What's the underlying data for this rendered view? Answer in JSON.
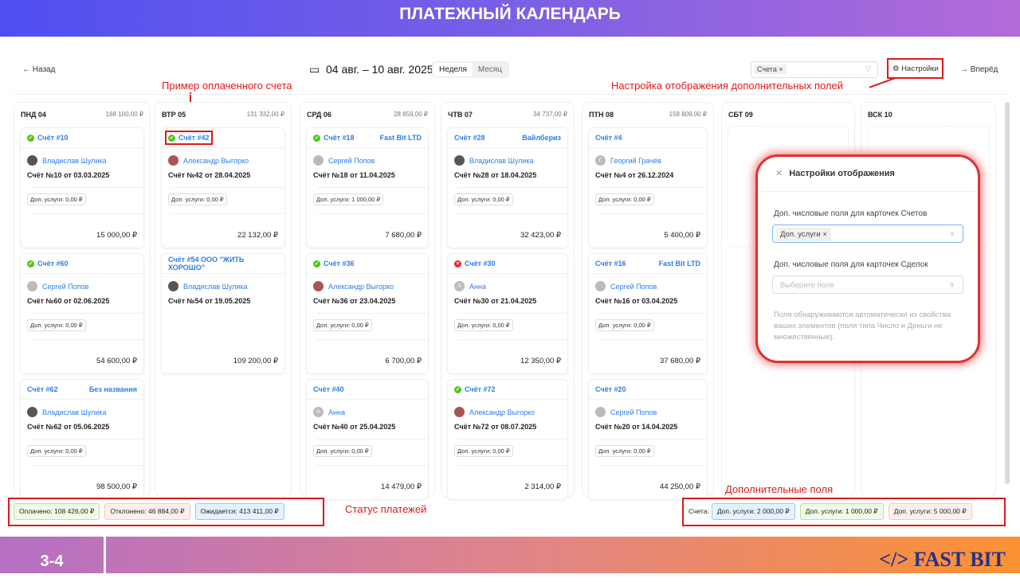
{
  "slide_title": "ПЛАТЕЖНЫЙ КАЛЕНДАРЬ",
  "page_number": "3-4",
  "logo_text": "</> FAST BIT",
  "toolbar": {
    "back": "Назад",
    "date_range": "04 авг. – 10 авг. 2025",
    "view_week": "Неделя",
    "view_month": "Месяц",
    "filter_chip": "Счета",
    "settings": "Настройки",
    "forward": "Вперёд"
  },
  "annotations": {
    "paid_example": "Пример оплаченного счета",
    "settings_note": "Настройка отображения дополнительных полей",
    "status_note": "Статус платежей",
    "extra_note": "Дополнительные поля"
  },
  "colors": {
    "paid": "#52c41a",
    "declined": "#f5222d",
    "link": "#2b7de9",
    "annotation": "#e01818"
  },
  "columns": [
    {
      "day": "ПНД 04",
      "total": "168 100,00 ₽",
      "cards": [
        {
          "title": "Счёт #10",
          "status": "paid",
          "org": "",
          "person": "Владислав Шулика",
          "av": "#555",
          "inv": "Счёт №10 от 03.03.2025",
          "tag": "Доп. услуги: 0,00 ₽",
          "amount": "15 000,00 ₽"
        },
        {
          "title": "Счёт #60",
          "status": "paid",
          "org": "",
          "person": "Сергей Попов",
          "av": "#bbb",
          "inv": "Счёт №60 от 02.06.2025",
          "tag": "Доп. услуги: 0,00 ₽",
          "amount": "54 600,00 ₽"
        },
        {
          "title": "Счёт #62",
          "status": "",
          "org": "Без названия",
          "person": "Владислав Шулика",
          "av": "#555",
          "inv": "Счёт №62 от 05.06.2025",
          "tag": "Доп. услуги: 0,00 ₽",
          "amount": "98 500,00 ₽"
        }
      ]
    },
    {
      "day": "ВТР 05",
      "total": "131 332,00 ₽",
      "cards": [
        {
          "title": "Счёт #42",
          "status": "paid",
          "org": "",
          "person": "Александр Выгорко",
          "av": "#a55",
          "inv": "Счёт №42 от 28.04.2025",
          "tag": "Доп. услуги: 0,00 ₽",
          "amount": "22 132,00 ₽"
        },
        {
          "title": "Счёт #54 ООО \"ЖИТЬ ХОРОШО\"",
          "status": "",
          "org": "",
          "person": "Владислав Шулика",
          "av": "#555",
          "inv": "Счёт №54 от 19.05.2025",
          "tag": "",
          "amount": "109 200,00 ₽"
        }
      ]
    },
    {
      "day": "СРД 06",
      "total": "28 859,00 ₽",
      "cards": [
        {
          "title": "Счёт #18",
          "status": "paid",
          "org": "Fast Bit LTD",
          "person": "Сергей Попов",
          "av": "#bbb",
          "inv": "Счёт №18 от 11.04.2025",
          "tag": "Доп. услуги: 1 000,00 ₽",
          "amount": "7 680,00 ₽"
        },
        {
          "title": "Счёт #36",
          "status": "paid",
          "org": "",
          "person": "Александр Выгорко",
          "av": "#a55",
          "inv": "Счёт №36 от 23.04.2025",
          "tag": "Доп. услуги: 0,00 ₽",
          "amount": "6 700,00 ₽"
        },
        {
          "title": "Счёт #40",
          "status": "",
          "org": "",
          "person": "Анна",
          "av": "#bbb",
          "letter": "А",
          "inv": "Счёт №40 от 25.04.2025",
          "tag": "Доп. услуги: 0,00 ₽",
          "amount": "14 479,00 ₽"
        }
      ]
    },
    {
      "day": "ЧТВ 07",
      "total": "34 737,00 ₽",
      "cards": [
        {
          "title": "Счёт #28",
          "status": "",
          "org": "Вайлбериз",
          "person": "Владислав Шулика",
          "av": "#555",
          "inv": "Счёт №28 от 18.04.2025",
          "tag": "Доп. услуги: 0,00 ₽",
          "amount": "32 423,00 ₽"
        },
        {
          "title": "Счёт #30",
          "status": "declined",
          "org": "",
          "person": "Анна",
          "av": "#bbb",
          "letter": "А",
          "inv": "Счёт №30 от 21.04.2025",
          "tag": "Доп. услуги: 0,00 ₽",
          "amount": "12 350,00 ₽"
        },
        {
          "title": "Счёт #72",
          "status": "paid",
          "org": "",
          "person": "Александр Выгорко",
          "av": "#a55",
          "inv": "Счёт №72 от 08.07.2025",
          "tag": "Доп. услуги: 0,00 ₽",
          "amount": "2 314,00 ₽"
        }
      ]
    },
    {
      "day": "ПТН 08",
      "total": "158 809,00 ₽",
      "cards": [
        {
          "title": "Счёт #4",
          "status": "",
          "org": "",
          "person": "Георгий Грачёв",
          "av": "#bbb",
          "letter": "Г",
          "inv": "Счёт №4 от 26.12.2024",
          "tag": "Доп. услуги: 0,00 ₽",
          "amount": "5 400,00 ₽"
        },
        {
          "title": "Счёт #16",
          "status": "",
          "org": "Fast Bit LTD",
          "person": "Сергей Попов",
          "av": "#bbb",
          "inv": "Счёт №16 от 03.04.2025",
          "tag": "Доп. услуги: 0,00 ₽",
          "amount": "37 680,00 ₽"
        },
        {
          "title": "Счёт #20",
          "status": "",
          "org": "",
          "person": "Сергей Попов",
          "av": "#bbb",
          "inv": "Счёт №20 от 14.04.2025",
          "tag": "Доп. услуги: 0,00 ₽",
          "amount": "44 250,00 ₽"
        }
      ]
    },
    {
      "day": "СБТ 09",
      "total": "",
      "cards": []
    },
    {
      "day": "ВСК 10",
      "total": "",
      "cards": []
    }
  ],
  "status_summary": {
    "paid": "Оплачено: 108 426,00 ₽",
    "declined": "Отклонено: 46 884,00 ₽",
    "pending": "Ожидается: 413 411,00 ₽"
  },
  "extra_summary": {
    "label": "Счета:",
    "items": [
      "Доп. услуги: 2 000,00 ₽",
      "Доп. услуги: 1 000,00 ₽",
      "Доп. услуги: 5 000,00 ₽"
    ]
  },
  "modal": {
    "title": "Настройки отображения",
    "invoice_fields_label": "Доп. числовые поля для карточек Счетов",
    "invoice_fields_chip": "Доп. услуги",
    "deal_fields_label": "Доп. числовые поля для карточек Сделок",
    "deal_fields_placeholder": "Выберите поля",
    "hint": "Поля обнаруживаются автоматически из свойства ваших элементов (поля типа Число и Деньги не множественные)."
  }
}
